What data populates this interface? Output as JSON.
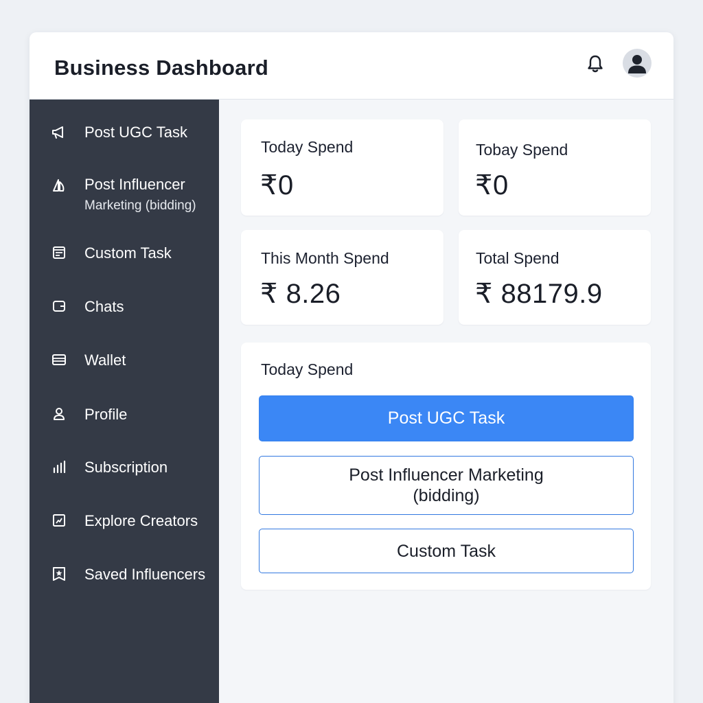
{
  "header": {
    "title": "Business Dashboard",
    "icons": {
      "notifications": "bell-icon",
      "account": "user-avatar-icon"
    }
  },
  "sidebar": {
    "items": [
      {
        "label": "Post UGC Task",
        "icon": "megaphone-icon"
      },
      {
        "label": "Post Influencer",
        "sublabel": "Marketing (bidding)",
        "icon": "sail-icon"
      },
      {
        "label": "Custom Task",
        "icon": "document-icon"
      },
      {
        "label": "Chats",
        "icon": "chat-icon"
      },
      {
        "label": "Wallet",
        "icon": "wallet-icon"
      },
      {
        "label": "Profile",
        "icon": "person-icon"
      },
      {
        "label": "Subscription",
        "icon": "bar-chart-icon"
      },
      {
        "label": "Explore Creators",
        "icon": "explore-icon"
      },
      {
        "label": "Saved Influencers",
        "icon": "star-bookmark-icon"
      }
    ]
  },
  "stats": [
    {
      "label": "Today Spend",
      "value": "₹0"
    },
    {
      "label": "Tobay  Spend",
      "value": "₹0"
    },
    {
      "label": "This Month Spend",
      "value": "₹ 8.26"
    },
    {
      "label": "Total Spend",
      "value": "₹ 88179.9"
    }
  ],
  "actions": {
    "title": "Today Spend",
    "primary": "Post UGC Task",
    "influencer_line1": "Post Influencer Marketing",
    "influencer_line2": "(bidding)",
    "custom": "Custom Task"
  },
  "colors": {
    "sidebar": "#343a46",
    "primary": "#3b87f5",
    "outline": "#3178e0",
    "background": "#f4f6f9"
  }
}
